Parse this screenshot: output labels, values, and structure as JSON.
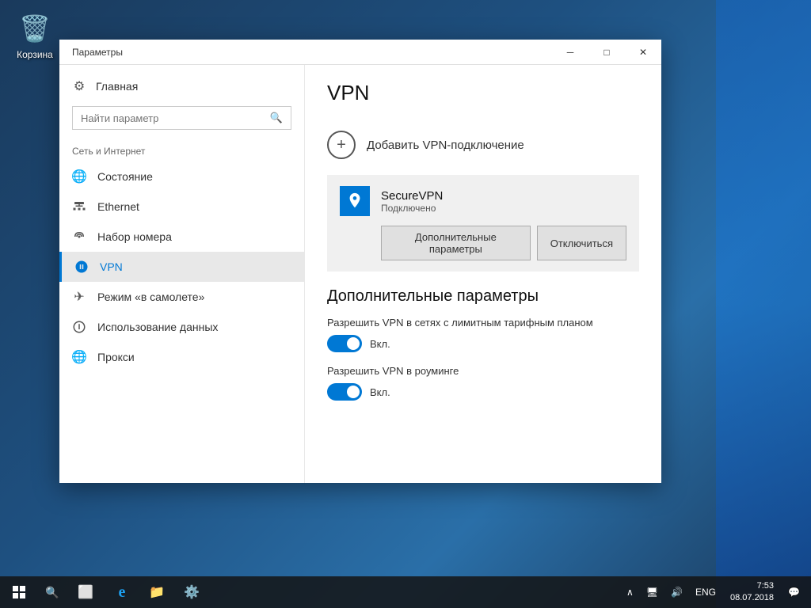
{
  "desktop": {
    "recycle_bin_label": "Корзина"
  },
  "window": {
    "title": "Параметры",
    "minimize_label": "─",
    "maximize_label": "□",
    "close_label": "✕"
  },
  "sidebar": {
    "home_label": "Главная",
    "search_placeholder": "Найти параметр",
    "section_label": "Сеть и Интернет",
    "items": [
      {
        "id": "status",
        "label": "Состояние",
        "icon": "🌐"
      },
      {
        "id": "ethernet",
        "label": "Ethernet",
        "icon": "🖥"
      },
      {
        "id": "dialup",
        "label": "Набор номера",
        "icon": "📡"
      },
      {
        "id": "vpn",
        "label": "VPN",
        "icon": "🔗",
        "active": true
      },
      {
        "id": "airplane",
        "label": "Режим «в самолете»",
        "icon": "✈"
      },
      {
        "id": "datausage",
        "label": "Использование данных",
        "icon": "🌐"
      },
      {
        "id": "proxy",
        "label": "Прокси",
        "icon": "🌐"
      }
    ]
  },
  "content": {
    "title": "VPN",
    "add_vpn_label": "Добавить VPN-подключение",
    "vpn_connection": {
      "name": "SecureVPN",
      "status": "Подключено",
      "btn_advanced": "Дополнительные параметры",
      "btn_disconnect": "Отключиться"
    },
    "additional_section_title": "Дополнительные параметры",
    "toggle1": {
      "desc": "Разрешить VPN в сетях с лимитным тарифным планом",
      "state": "Вкл.",
      "enabled": true
    },
    "toggle2": {
      "desc": "Разрешить VPN в роуминге",
      "state": "Вкл.",
      "enabled": true
    }
  },
  "taskbar": {
    "time": "7:53",
    "date": "08.07.2018",
    "lang": "ENG",
    "system_tray_arrow": "∧",
    "notification_icon": "💬"
  }
}
